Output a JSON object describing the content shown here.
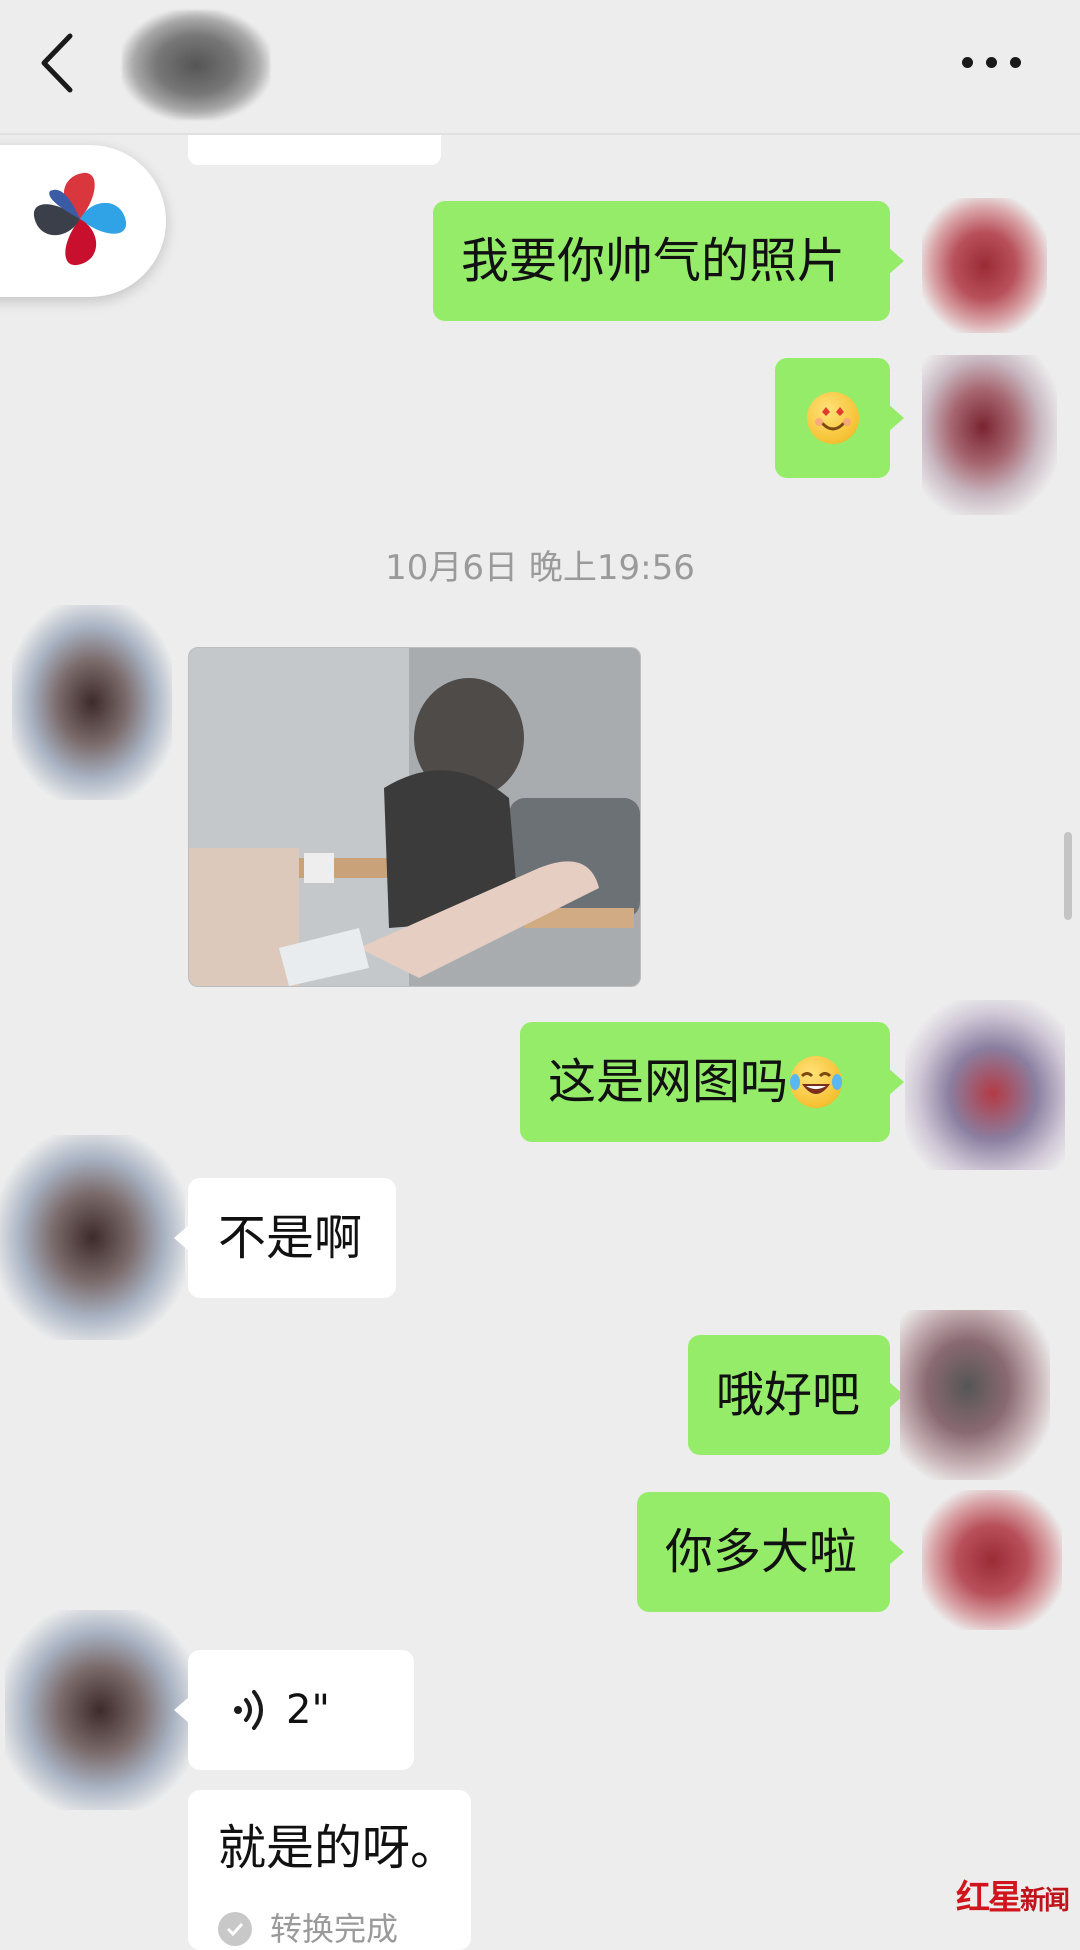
{
  "header": {
    "back_icon": "chevron-left-icon",
    "more_icon": "more-horizontal-icon"
  },
  "messages": {
    "m1": "我要你帅气的照片",
    "m2_emoji": "heart-eyes-smile-emoji",
    "timestamp": "10月6日 晚上19:56",
    "m3_image": "photo-message",
    "m4": "这是网图吗",
    "m4_emoji": "tears-of-joy-emoji",
    "m5": "不是啊",
    "m6": "哦好吧",
    "m7": "你多大啦",
    "voice_duration": "2\"",
    "voice_transcript": "就是的呀。",
    "transcript_status": "转换完成"
  },
  "watermark": {
    "brand_part1": "红星",
    "brand_part2": "新闻"
  },
  "colors": {
    "background": "#ededed",
    "sent_bubble": "#95ec69",
    "received_bubble": "#ffffff",
    "timestamp_text": "#9a9a9a",
    "watermark_red": "#d0161c"
  }
}
